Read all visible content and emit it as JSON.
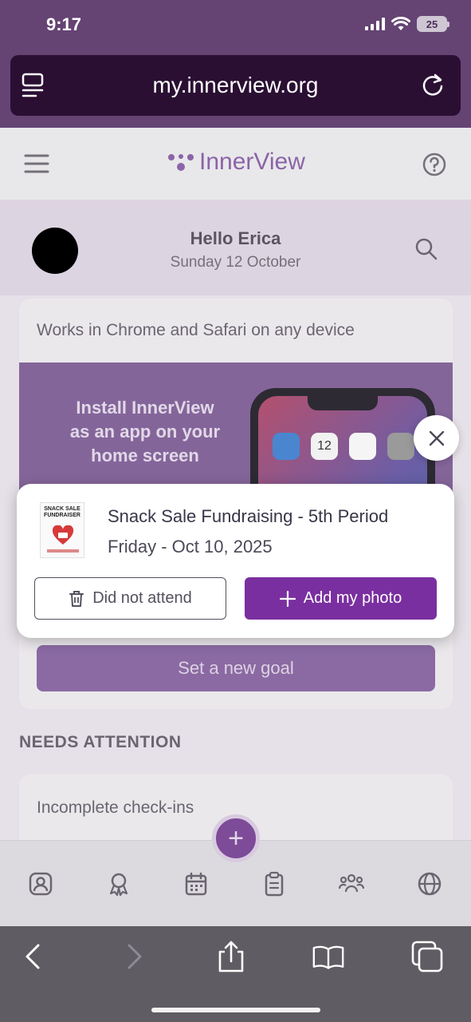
{
  "status_bar": {
    "time": "9:17",
    "battery": "25"
  },
  "browser": {
    "url": "my.innerview.org"
  },
  "app": {
    "logo_text": "InnerView"
  },
  "greeting": {
    "title": "Hello Erica",
    "date": "Sunday 12 October"
  },
  "card": {
    "note": "Works in Chrome and Safari on any device",
    "install_text": "Install InnerView\nas an app on your\nhome screen",
    "phone_date": "12",
    "set_goal_label": "Set a new goal"
  },
  "needs_attention": {
    "heading": "NEEDS ATTENTION",
    "card_title": "Incomplete check-ins"
  },
  "popup": {
    "thumbnail_title": "SNACK SALE\nFUNDRAISER",
    "event_title": "Snack Sale Fundraising - 5th Period",
    "event_date": "Friday - Oct 10, 2025",
    "did_not_attend_label": "Did not attend",
    "add_photo_label": "Add my photo"
  },
  "fab": {
    "label": "+"
  },
  "bottom_nav": {
    "items": [
      {
        "icon": "profile-icon"
      },
      {
        "icon": "badge-icon"
      },
      {
        "icon": "calendar-icon"
      },
      {
        "icon": "clipboard-icon"
      },
      {
        "icon": "group-icon"
      },
      {
        "icon": "globe-icon"
      }
    ]
  },
  "colors": {
    "brand_purple": "#7a2fa0",
    "browser_chrome": "#654474"
  }
}
